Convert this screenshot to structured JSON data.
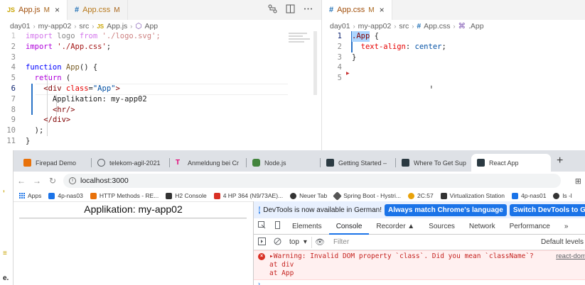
{
  "editor": {
    "left_tabs": [
      {
        "icon": "JS",
        "name": "App.js",
        "status": "M",
        "close": "×",
        "active": true
      },
      {
        "icon": "#",
        "name": "App.css",
        "status": "M",
        "active": false
      }
    ],
    "right_tabs": [
      {
        "icon": "#",
        "name": "App.css",
        "status": "M",
        "close": "×",
        "active": true
      }
    ],
    "left_breadcrumb": [
      "day01",
      "my-app02",
      "src",
      "App.js",
      "App"
    ],
    "right_breadcrumb": [
      "day01",
      "my-app02",
      "src",
      "App.css",
      ".App"
    ],
    "left_lines": [
      {
        "n": "1",
        "tokens": [
          {
            "t": "import",
            "c": "kw2"
          },
          {
            "t": " logo ",
            "c": "plain"
          },
          {
            "t": "from",
            "c": "kw2"
          },
          {
            "t": " './logo.svg';",
            "c": "str"
          }
        ],
        "faded": true
      },
      {
        "n": "2",
        "tokens": [
          {
            "t": "import",
            "c": "kw2"
          },
          {
            "t": " './App.css'",
            "c": "str"
          },
          {
            "t": ";",
            "c": "plain"
          }
        ]
      },
      {
        "n": "3",
        "tokens": []
      },
      {
        "n": "4",
        "tokens": [
          {
            "t": "function",
            "c": "kw"
          },
          {
            "t": " ",
            "c": "plain"
          },
          {
            "t": "App",
            "c": "fn"
          },
          {
            "t": "() {",
            "c": "plain"
          }
        ]
      },
      {
        "n": "5",
        "tokens": [
          {
            "t": "  ",
            "c": "plain"
          },
          {
            "t": "return",
            "c": "kw2"
          },
          {
            "t": " (",
            "c": "plain"
          }
        ]
      },
      {
        "n": "6",
        "tokens": [
          {
            "t": "    ",
            "c": "plain"
          },
          {
            "t": "<div",
            "c": "tag"
          },
          {
            "t": " ",
            "c": "plain"
          },
          {
            "t": "class",
            "c": "attr"
          },
          {
            "t": "=",
            "c": "plain"
          },
          {
            "t": "\"App\"",
            "c": "val"
          },
          {
            "t": ">",
            "c": "tag"
          }
        ],
        "current": true
      },
      {
        "n": "7",
        "tokens": [
          {
            "t": "      Applikation: my-app02",
            "c": "plain"
          }
        ]
      },
      {
        "n": "8",
        "tokens": [
          {
            "t": "      ",
            "c": "plain"
          },
          {
            "t": "<hr/>",
            "c": "tag"
          }
        ]
      },
      {
        "n": "9",
        "tokens": [
          {
            "t": "    ",
            "c": "plain"
          },
          {
            "t": "</div>",
            "c": "tag"
          }
        ]
      },
      {
        "n": "10",
        "tokens": [
          {
            "t": "  );",
            "c": "plain"
          }
        ]
      },
      {
        "n": "11",
        "tokens": [
          {
            "t": "}",
            "c": "plain"
          }
        ]
      }
    ],
    "right_lines": [
      {
        "n": "1",
        "tokens": [
          {
            "t": ".App",
            "c": "sel",
            "hl": true
          },
          {
            "t": " {",
            "c": "plain"
          }
        ],
        "current": true
      },
      {
        "n": "2",
        "tokens": [
          {
            "t": "  ",
            "c": "plain"
          },
          {
            "t": "text-align",
            "c": "prop"
          },
          {
            "t": ": ",
            "c": "plain"
          },
          {
            "t": "center",
            "c": "val"
          },
          {
            "t": ";",
            "c": "plain"
          }
        ]
      },
      {
        "n": "3",
        "tokens": [
          {
            "t": "}",
            "c": "plain"
          }
        ]
      },
      {
        "n": "4",
        "tokens": []
      },
      {
        "n": "5",
        "tokens": []
      }
    ]
  },
  "browser": {
    "tabs": [
      {
        "title": "Firepad Demo",
        "color": "#e8710a"
      },
      {
        "title": "telekom-agil-2021",
        "color": "#5f6368"
      },
      {
        "title": "Anmeldung bei Cr",
        "color": "#e20074"
      },
      {
        "title": "Node.js",
        "color": "#43853d"
      },
      {
        "title": "Getting Started –",
        "color": "#2b3a42"
      },
      {
        "title": "Where To Get Sup",
        "color": "#2b3a42"
      },
      {
        "title": "React App",
        "color": "#2b3a42",
        "active": true
      }
    ],
    "new_tab": "+",
    "url": "localhost:3000",
    "bookmarks": [
      {
        "label": "Apps",
        "color": "#1a73e8"
      },
      {
        "label": "4p-nas03",
        "color": "#1a73e8"
      },
      {
        "label": "HTTP Methods - RE...",
        "color": "#e8710a"
      },
      {
        "label": "H2 Console",
        "color": "#333333"
      },
      {
        "label": "4 HP 364 (N9/73AE)...",
        "color": "#d93025"
      },
      {
        "label": "Neuer Tab",
        "color": "#333333"
      },
      {
        "label": "Spring Boot - Hystri...",
        "color": "#333333"
      },
      {
        "label": "2C:57",
        "color": "#e8a20a"
      },
      {
        "label": "Virtualization Station",
        "color": "#333333"
      },
      {
        "label": "4p-nas01",
        "color": "#1a73e8"
      },
      {
        "label": "ls -l",
        "color": "#333333"
      }
    ],
    "page": {
      "heading": "Applikation: my-app02"
    },
    "devtools": {
      "banner_text": "DevTools is now available in German!",
      "banner_btn1": "Always match Chrome's language",
      "banner_btn2": "Switch DevTools to German",
      "tabs": [
        "Elements",
        "Console",
        "Recorder ▲",
        "Sources",
        "Network",
        "Performance",
        "»"
      ],
      "active_tab": "Console",
      "context": "top",
      "filter_placeholder": "Filter",
      "levels": "Default levels",
      "error_lines": [
        "▸Warning: Invalid DOM property `class`. Did you mean `className`?",
        "    at div",
        "    at App"
      ],
      "error_source": "react-dom",
      "prompt": "›"
    }
  },
  "left_strip_markers": [
    ",",
    "≡",
    "e."
  ]
}
